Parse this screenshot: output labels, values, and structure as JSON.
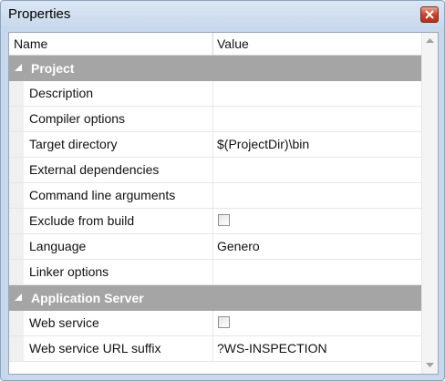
{
  "window": {
    "title": "Properties"
  },
  "columns": {
    "name": "Name",
    "value": "Value"
  },
  "categories": [
    {
      "label": "Project",
      "properties": [
        {
          "name": "Description",
          "value": ""
        },
        {
          "name": "Compiler options",
          "value": ""
        },
        {
          "name": "Target directory",
          "value": "$(ProjectDir)\\bin"
        },
        {
          "name": "External dependencies",
          "value": ""
        },
        {
          "name": "Command line arguments",
          "value": ""
        },
        {
          "name": "Exclude from build",
          "checkbox": true,
          "checked": false
        },
        {
          "name": "Language",
          "value": "Genero"
        },
        {
          "name": "Linker options",
          "value": ""
        }
      ]
    },
    {
      "label": "Application Server",
      "properties": [
        {
          "name": "Web service",
          "checkbox": true,
          "checked": false
        },
        {
          "name": "Web service URL suffix",
          "value": "?WS-INSPECTION"
        }
      ]
    }
  ],
  "colors": {
    "category_bg": "#a5a5a5",
    "close_button": "#c8432b",
    "frame": "#c8d8ec"
  },
  "icons": {
    "close": "close-icon",
    "collapse": "collapse-triangle-icon",
    "scroll_up": "scroll-up-arrow-icon",
    "scroll_down": "scroll-down-arrow-icon"
  }
}
